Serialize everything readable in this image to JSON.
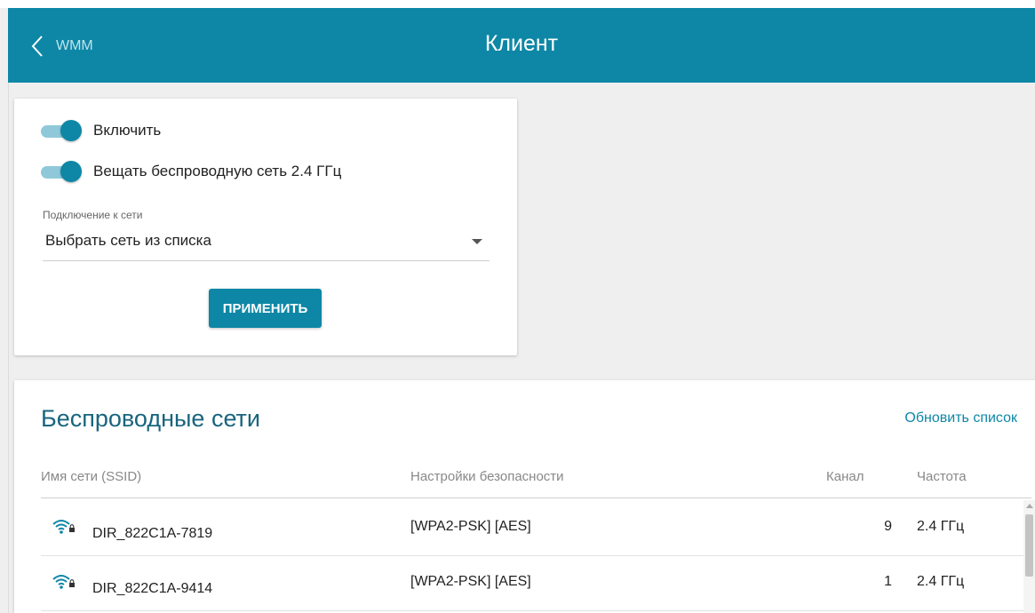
{
  "header": {
    "back_label": "WMM",
    "title": "Клиент"
  },
  "settings": {
    "enable_label": "Включить",
    "enable_on": true,
    "broadcast_label": "Вещать беспроводную сеть 2.4 ГГц",
    "broadcast_on": true,
    "connection_label": "Подключение к сети",
    "connection_value": "Выбрать сеть из списка",
    "apply_label": "ПРИМЕНИТЬ"
  },
  "networks": {
    "title": "Беспроводные сети",
    "refresh_label": "Обновить список",
    "columns": {
      "ssid": "Имя сети (SSID)",
      "security": "Настройки безопасности",
      "channel": "Канал",
      "frequency": "Частота"
    },
    "rows": [
      {
        "ssid": "DIR_822C1A-7819",
        "security": "[WPA2-PSK] [AES]",
        "channel": "9",
        "frequency": "2.4 ГГц",
        "icon": "wifi-lock-icon"
      },
      {
        "ssid": "DIR_822C1A-9414",
        "security": "[WPA2-PSK] [AES]",
        "channel": "1",
        "frequency": "2.4 ГГц",
        "icon": "wifi-lock-icon"
      }
    ]
  },
  "colors": {
    "accent": "#0e87a6",
    "title_text": "#18657e",
    "background": "#efefef"
  }
}
